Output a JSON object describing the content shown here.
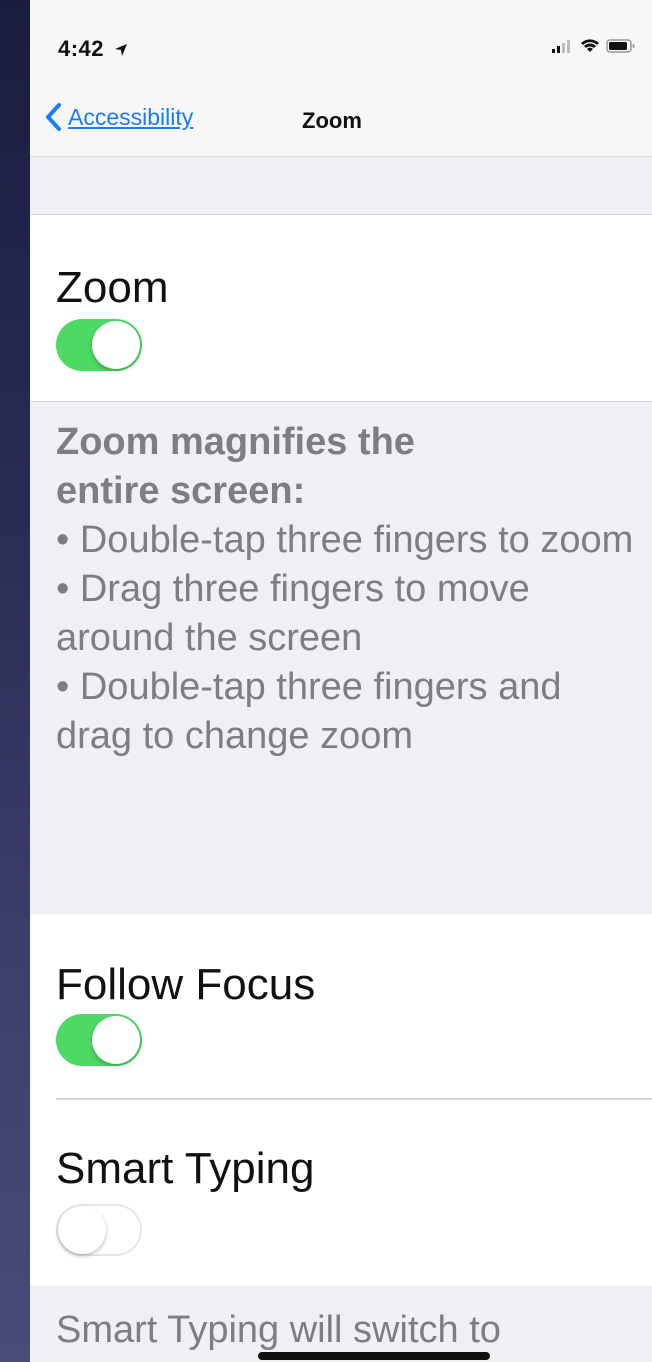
{
  "status_bar": {
    "time": "4:42",
    "location_icon": "location-arrow-icon",
    "signal_icon": "cellular-signal-icon",
    "wifi_icon": "wifi-icon",
    "battery_icon": "battery-icon"
  },
  "nav": {
    "back_label": "Accessibility",
    "back_icon": "chevron-left-icon",
    "title": "Zoom"
  },
  "settings": {
    "zoom": {
      "label": "Zoom",
      "enabled": true
    },
    "zoom_description": {
      "heading_line1": "Zoom magnifies the",
      "heading_line2": "entire screen:",
      "bullets": [
        "• Double-tap three fingers to zoom",
        "• Drag three fingers to move around the screen",
        "• Double-tap three fingers and drag to change zoom"
      ]
    },
    "follow_focus": {
      "label": "Follow Focus",
      "enabled": true
    },
    "smart_typing": {
      "label": "Smart Typing",
      "enabled": false
    },
    "smart_typing_description": "Smart Typing will switch to"
  },
  "colors": {
    "accent": "#1a7cf5",
    "switch_on": "#4cd964",
    "background": "#efeff4",
    "footer_text": "#7d7d82"
  }
}
